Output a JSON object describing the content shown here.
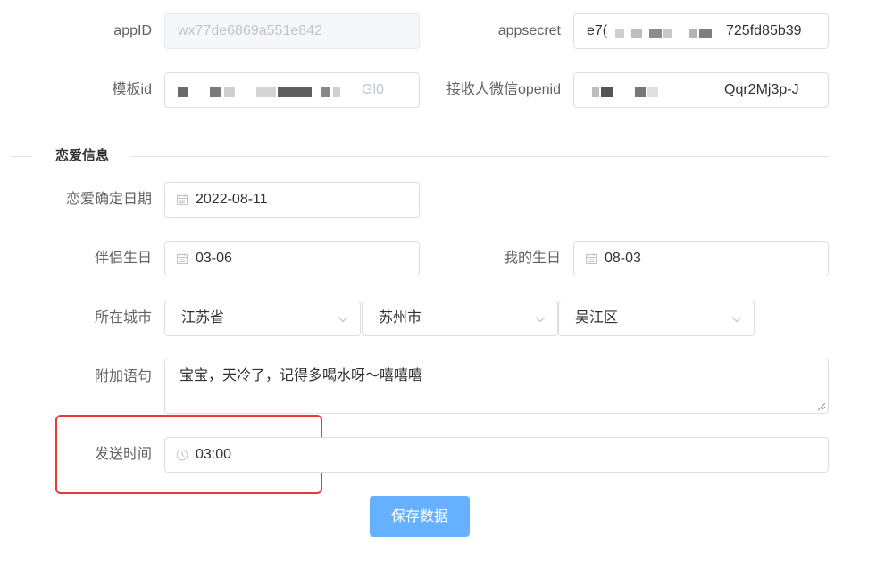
{
  "fields": {
    "appid": {
      "label": "appID",
      "value": "wx77de6869a551e842"
    },
    "appsecret": {
      "label": "appsecret",
      "value_start": "e7(",
      "value_end": "725fd85b39"
    },
    "template_id": {
      "label": "模板id",
      "value_end": "Gl0"
    },
    "openid": {
      "label": "接收人微信openid",
      "value_end": "Qqr2Mj3p-J"
    }
  },
  "section_title": "恋爱信息",
  "love_date": {
    "label": "恋爱确定日期",
    "value": "2022-08-11",
    "icon": "calendar-icon"
  },
  "partner_birthday": {
    "label": "伴侣生日",
    "value": "03-06",
    "icon": "calendar-icon"
  },
  "my_birthday": {
    "label": "我的生日",
    "value": "08-03",
    "icon": "calendar-icon"
  },
  "city": {
    "label": "所在城市",
    "province": "江苏省",
    "city": "苏州市",
    "district": "吴江区",
    "icon": "chevron-down-icon"
  },
  "extra_sentence": {
    "label": "附加语句",
    "value": "宝宝，天冷了，记得多喝水呀～嘻嘻嘻"
  },
  "send_time": {
    "label": "发送时间",
    "value": "03:00",
    "icon": "clock-icon"
  },
  "save_button": "保存数据",
  "colors": {
    "primary_light": "#66b1ff",
    "highlight": "#e53935",
    "border": "#dcdfe6"
  }
}
